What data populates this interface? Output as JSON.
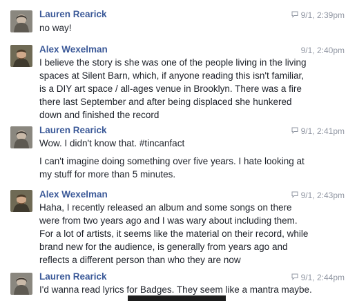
{
  "messages": [
    {
      "author": "Lauren Rearick",
      "time": "9/1, 2:39pm",
      "show_reply_icon": true,
      "paragraphs": [
        "no way!"
      ]
    },
    {
      "author": "Alex Wexelman",
      "time": "9/1, 2:40pm",
      "show_reply_icon": false,
      "paragraphs": [
        "I believe the story is she was one of the people living in the living spaces at Silent Barn, which, if anyone reading this isn't familiar, is a DIY art space / all-ages venue in Brooklyn. There was a fire there last September and after being displaced she hunkered down and finished the record"
      ]
    },
    {
      "author": "Lauren Rearick",
      "time": "9/1, 2:41pm",
      "show_reply_icon": true,
      "paragraphs": [
        "Wow. I didn't know that. #tincanfact",
        "I can't imagine doing something over five years. I hate looking at my stuff for more than 5 minutes."
      ]
    },
    {
      "author": "Alex Wexelman",
      "time": "9/1, 2:43pm",
      "show_reply_icon": true,
      "paragraphs": [
        "Haha, I recently released an album and some songs on there were from two years ago and I was wary about including them. For a lot of artists, it seems like the material on their record, while brand new for the audience, is generally from years ago and reflects a different person than who they are now"
      ]
    },
    {
      "author": "Lauren Rearick",
      "time": "9/1, 2:44pm",
      "show_reply_icon": true,
      "paragraphs": [
        "I'd wanna read lyrics for Badges. They seem like a mantra maybe."
      ]
    }
  ],
  "colors": {
    "author": "#3b5998",
    "timestamp": "#9197a3",
    "text": "#1d2129"
  },
  "icons": {
    "reply": "reply-icon"
  }
}
